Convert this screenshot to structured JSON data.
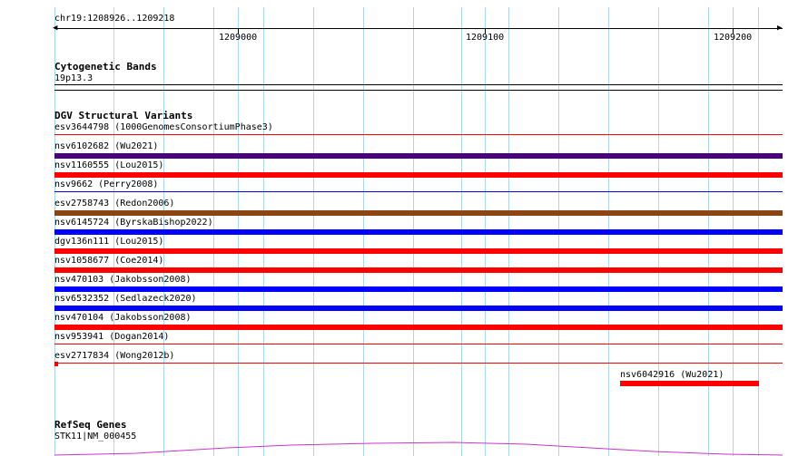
{
  "ruler": {
    "region": "chr19:1208926..1209218",
    "ticks": [
      "1209000",
      "1209100",
      "1209200"
    ]
  },
  "cytoband": {
    "title": "Cytogenetic Bands",
    "band": "19p13.3"
  },
  "dgv": {
    "title": "DGV Structural Variants",
    "variants": [
      {
        "label": "esv3644798 (1000GenomesConsortiumPhase3)",
        "color": "#ff0000",
        "style": "thin"
      },
      {
        "label": "nsv6102682 (Wu2021)",
        "color": "#4b0082",
        "style": "thick"
      },
      {
        "label": "nsv1160555 (Lou2015)",
        "color": "#ff0000",
        "style": "thick"
      },
      {
        "label": "nsv9662 (Perry2008)",
        "color": "#0000ff",
        "style": "thin"
      },
      {
        "label": "esv2758743 (Redon2006)",
        "color": "#8b4513",
        "style": "thick"
      },
      {
        "label": "nsv6145724 (ByrskaBishop2022)",
        "color": "#0000ff",
        "style": "thick"
      },
      {
        "label": "dgv136n111 (Lou2015)",
        "color": "#ff0000",
        "style": "thick"
      },
      {
        "label": "nsv1058677 (Coe2014)",
        "color": "#ff0000",
        "style": "thick"
      },
      {
        "label": "nsv470103 (Jakobsson2008)",
        "color": "#0000ff",
        "style": "thick"
      },
      {
        "label": "nsv6532352 (Sedlazeck2020)",
        "color": "#0000ff",
        "style": "thick"
      },
      {
        "label": "nsv470104 (Jakobsson2008)",
        "color": "#ff0000",
        "style": "thick"
      },
      {
        "label": "nsv953941 (Dogan2014)",
        "color": "#ff0000",
        "style": "thin"
      },
      {
        "label": "esv2717834 (Wong2012b)",
        "color": "#ff0000",
        "style": "thin"
      }
    ],
    "partial_variant": {
      "label": "nsv6042916 (Wu2021)",
      "color": "#ff0000"
    }
  },
  "refseq": {
    "title": "RefSeq Genes",
    "gene": "STK11|NM_000455",
    "color": "#cc33cc"
  }
}
